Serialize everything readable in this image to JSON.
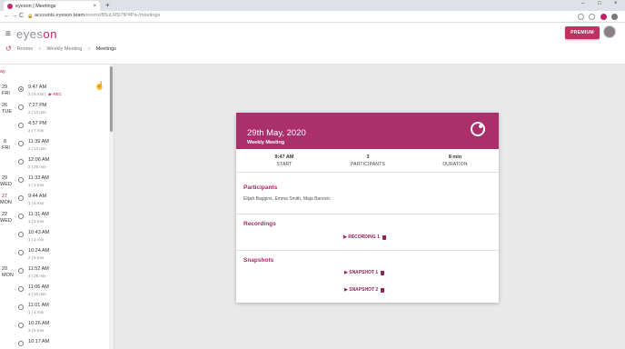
{
  "browser": {
    "tab_title": "eyeson | Meetings",
    "url_domain": "accounts.eyeson.team",
    "url_path": "/rooms/B5uLR5l7fP4Pa-/meetings",
    "new_tab": "+",
    "close": "×",
    "back": "←",
    "forward": "→",
    "reload": "C",
    "lock": "🔒",
    "minimize": "–",
    "maximize": "□"
  },
  "header": {
    "menu": "≡",
    "logo_main": "eyes",
    "logo_accent": "on",
    "premium_label": "PREMIUM"
  },
  "breadcrumb": {
    "icon": "↺",
    "items": [
      "Rooms",
      "Weekly Meeting",
      "Meetings"
    ],
    "separator": ">"
  },
  "sidebar": {
    "month_label": "ay",
    "days": [
      {
        "num": "29",
        "day": "FRI",
        "red": false
      },
      {
        "num": "26",
        "day": "TUE",
        "red": false
      },
      {
        "num": "8",
        "day": "FRI",
        "red": false
      },
      {
        "num": "29",
        "day": "WED",
        "red": false
      },
      {
        "num": "27",
        "day": "MON",
        "red": true
      },
      {
        "num": "22",
        "day": "WED",
        "red": false
      },
      {
        "num": "20",
        "day": "MON",
        "red": false
      }
    ],
    "meetings": [
      {
        "time": "9:47 AM",
        "meta": "3 | 8 min |",
        "rec": "▶ REC",
        "selected": true
      },
      {
        "time": "7:27 PM",
        "meta": "2 | 12 min"
      },
      {
        "time": "4:57 PM",
        "meta": "2 | 7 min"
      },
      {
        "time": "11:39 AM",
        "meta": "2 | 12 min"
      },
      {
        "time": "12:06 AM",
        "meta": "2 | 25 min"
      },
      {
        "time": "11:33 AM",
        "meta": "1 | 4 min"
      },
      {
        "time": "9:44 AM",
        "meta": "1 | 6 min"
      },
      {
        "time": "11:31 AM",
        "meta": "1 | 2 min"
      },
      {
        "time": "10:43 AM",
        "meta": "1 | 2 min"
      },
      {
        "time": "10:24 AM",
        "meta": "2 | 5 min"
      },
      {
        "time": "11:52 AM",
        "meta": "4 | 28 min"
      },
      {
        "time": "11:06 AM",
        "meta": "4 | 20 min"
      },
      {
        "time": "11:01 AM",
        "meta": "1 | 4 min"
      },
      {
        "time": "10:26 AM",
        "meta": "3 | 6 min"
      },
      {
        "time": "10:17 AM",
        "meta": ""
      }
    ]
  },
  "card": {
    "date": "29th May, 2020",
    "room": "Weekly Meeting",
    "stats": [
      {
        "value": "9:47 AM",
        "label": "START"
      },
      {
        "value": "3",
        "label": "PARTICIPANTS"
      },
      {
        "value": "8 min",
        "label": "DURATION"
      }
    ],
    "participants_title": "Participants",
    "participants": "Elijah Baggins, Emma Smith, Maja Banovic",
    "recordings_title": "Recordings",
    "recording": "▶ RECORDING 1",
    "snapshots_title": "Snapshots",
    "snapshot1": "▶ SNAPSHOT 1",
    "snapshot2": "▶ SNAPSHOT 2"
  },
  "colors": {
    "brand": "#ab2f6b",
    "premium": "#c2305f"
  }
}
